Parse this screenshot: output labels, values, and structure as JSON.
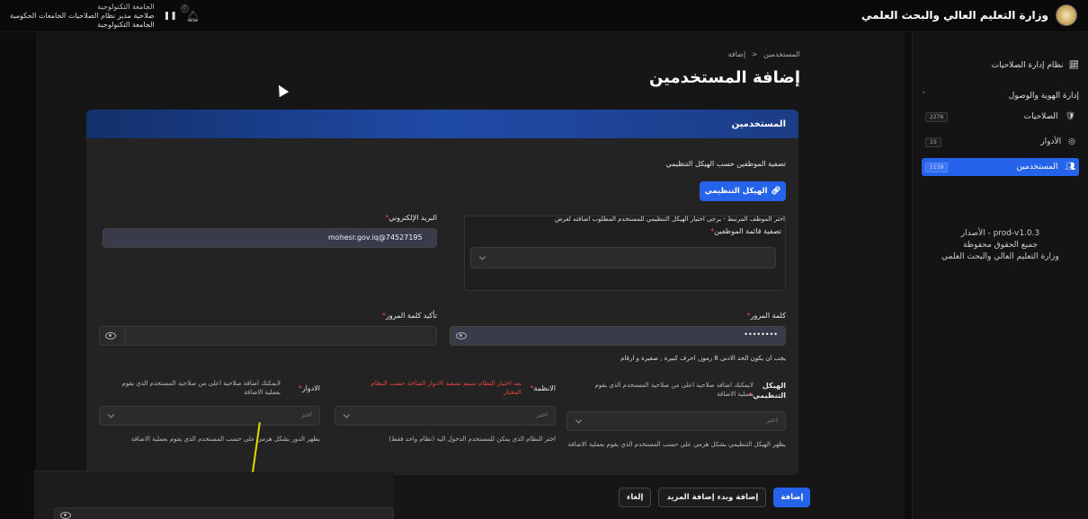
{
  "topbar": {
    "ministry_title": "وزارة التعليم العالي والبحث العلمي",
    "user_line1": "الجامعة التكنولوجية",
    "user_line2": "صلاحية مدير نظام الصلاحيات الجامعات الحكومية",
    "user_line3": "الجامعة التكنولوجية",
    "pause_icon": "pause-icon",
    "bell_icon": "bell-icon",
    "bell_badge": "0"
  },
  "sidebar": {
    "system_label": "نظام إدارة الصلاحيات",
    "section_label": "إدارة الهوية والوصول",
    "items": [
      {
        "label": "الصلاحيات",
        "badge": "2276",
        "icon": "shield-icon"
      },
      {
        "label": "الأدوار",
        "badge": "15",
        "icon": "fingerprint-icon"
      },
      {
        "label": "المستخدمين",
        "badge": "1139",
        "icon": "users-icon"
      }
    ],
    "version": "prod-v1.0.3 - الأصدار",
    "rights": "جميع الحقوق محفوظة",
    "ministry": "وزارة التعليم العالي والبحث العلمي"
  },
  "main": {
    "breadcrumb_parent": "المستخدمين",
    "breadcrumb_sep": "<",
    "breadcrumb_current": "إضافة",
    "page_title": "إضافة المستخدمين"
  },
  "card": {
    "header": "المستخدمين",
    "filter_title": "تصفية الموظفين حسب الهيكل التنظيمي",
    "org_button": "الهيكل التنظيمي",
    "employee_hint": "اختر الموظف المرتبط - يرجى اختيار الهيكل التنظيمي للمستخدم المطلوب اضافته لغرض",
    "employee_label": "تصفية قائمة الموظفين",
    "email_label": "البريد الإلكتروني",
    "email_value": "mohesr.gov.iq@74527195",
    "password_label": "كلمة المرور",
    "password_value": "••••••••",
    "confirm_label": "تأكيد كلمة المرور",
    "password_rule": "يجب ان يكون الحد الادنى 8 رموز, احرف كبيرة , صغيرة و ارقام",
    "org_label": "الهيكل التنظيمي",
    "org_hint": "لايمكنك اضافة صلاحية اعلى من صلاحية المستخدم الذي يقوم بعملية الاضافة",
    "org_placeholder": "اختر",
    "org_help": "يظهر الهيكل التنظيمي بشكل هرمي على حسب المستخدم الذي يقوم بعملية الاضافة",
    "systems_label": "الانظمة",
    "systems_warn": "بعد اختيار النظام سيتم تصفية الادوار المتاحة حسب النظام المختار",
    "systems_placeholder": "اختر",
    "systems_help": "اختر النظام الذي يمكن للمستخدم الدخول اليه (نظام واحد فقط)",
    "roles_label": "الادوار",
    "roles_hint": "لايمكنك اضافة صلاحية اعلى من صلاحية المستخدم الذي يقوم بعملية الاضافة",
    "roles_placeholder": "اختر",
    "roles_help": "يظهر الدور بشكل هرمي على حسب المستخدم الذي يقوم بعملية الاضافة"
  },
  "footer": {
    "add": "إضافة",
    "add_more": "إضافة وبدء إضافة المزيد",
    "cancel": "إلغاء"
  },
  "colors": {
    "accent": "#2563eb",
    "warn": "#ef4444",
    "annotation": "#e6d900"
  }
}
